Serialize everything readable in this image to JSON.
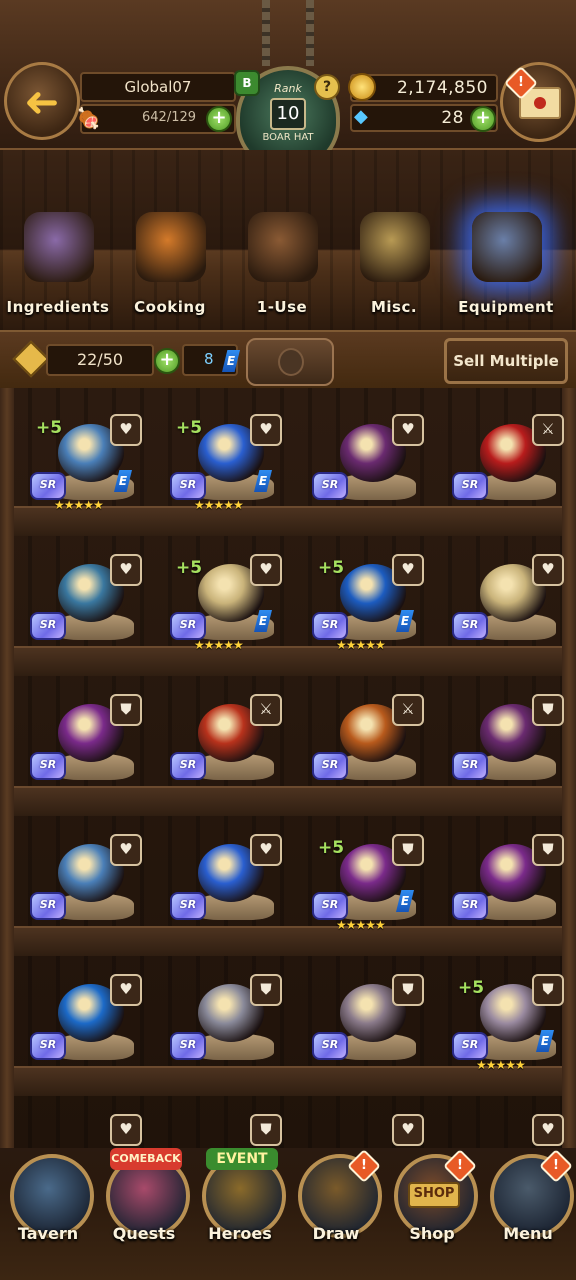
{
  "header": {
    "player_name": "Global07",
    "stamina": "642/129",
    "rank_label": "Rank",
    "rank_value": "10",
    "rank_title": "BOAR HAT",
    "rank_badge_letter": "B",
    "help_glyph": "?",
    "gold": "2,174,850",
    "gems": "28",
    "plus_glyph": "+",
    "alert_glyph": "!",
    "back_glyph": "➜"
  },
  "categories": [
    {
      "label": "Ingredients",
      "icon": "ingredients-icon",
      "active": false
    },
    {
      "label": "Cooking",
      "icon": "cooking-icon",
      "active": false
    },
    {
      "label": "1-Use",
      "icon": "one-use-bag-icon",
      "active": false
    },
    {
      "label": "Misc.",
      "icon": "misc-trophy-icon",
      "active": false
    },
    {
      "label": "Equipment",
      "icon": "equipment-armor-icon",
      "active": true
    }
  ],
  "inventory": {
    "count": "22/50",
    "tickets": "8",
    "e_label": "E",
    "sell_label": "Sell Multiple"
  },
  "grid": {
    "rarity_label": "SR",
    "e_label": "E",
    "items": [
      {
        "plus": "+5",
        "lock": "♥",
        "e": true,
        "stars": 5,
        "art": "#4a7fb8"
      },
      {
        "plus": "+5",
        "lock": "♥",
        "e": true,
        "stars": 5,
        "art": "#2a5fd0"
      },
      {
        "plus": "",
        "lock": "♥",
        "e": false,
        "stars": 0,
        "art": "#6a2a70"
      },
      {
        "plus": "",
        "lock": "⚔",
        "e": false,
        "stars": 0,
        "art": "#b81c1c"
      },
      {
        "plus": "",
        "lock": "♥",
        "e": false,
        "stars": 0,
        "art": "#3a78a0"
      },
      {
        "plus": "+5",
        "lock": "♥",
        "e": true,
        "stars": 5,
        "art": "#c9b37a"
      },
      {
        "plus": "+5",
        "lock": "♥",
        "e": true,
        "stars": 5,
        "art": "#1c5cc0"
      },
      {
        "plus": "",
        "lock": "♥",
        "e": false,
        "stars": 0,
        "art": "#c9b37a"
      },
      {
        "plus": "",
        "lock": "⛊",
        "e": false,
        "stars": 0,
        "art": "#7a2a8a"
      },
      {
        "plus": "",
        "lock": "⚔",
        "e": false,
        "stars": 0,
        "art": "#b8321c"
      },
      {
        "plus": "",
        "lock": "⚔",
        "e": false,
        "stars": 0,
        "art": "#b85a1c"
      },
      {
        "plus": "",
        "lock": "⛊",
        "e": false,
        "stars": 0,
        "art": "#6a2a70"
      },
      {
        "plus": "",
        "lock": "♥",
        "e": false,
        "stars": 0,
        "art": "#4a7fb8"
      },
      {
        "plus": "",
        "lock": "♥",
        "e": false,
        "stars": 0,
        "art": "#2a5fd0"
      },
      {
        "plus": "+5",
        "lock": "⛊",
        "e": true,
        "stars": 5,
        "art": "#7a2a8a"
      },
      {
        "plus": "",
        "lock": "⛊",
        "e": false,
        "stars": 0,
        "art": "#7a2a8a"
      },
      {
        "plus": "",
        "lock": "♥",
        "e": false,
        "stars": 0,
        "art": "#1c6ac8"
      },
      {
        "plus": "",
        "lock": "⛊",
        "e": false,
        "stars": 0,
        "art": "#8a8a9a"
      },
      {
        "plus": "",
        "lock": "⛊",
        "e": false,
        "stars": 0,
        "art": "#8a7a8a"
      },
      {
        "plus": "+5",
        "lock": "⛊",
        "e": true,
        "stars": 5,
        "art": "#9a8aa0"
      }
    ],
    "partial_row_locks": [
      "♥",
      "⛊",
      "♥",
      "♥"
    ]
  },
  "nav": [
    {
      "label": "Tavern",
      "icon": "tavern-hat-icon",
      "ribbon": "",
      "badge": false
    },
    {
      "label": "Quests",
      "icon": "quests-scroll-icon",
      "ribbon": "COMEBACK",
      "badge": false
    },
    {
      "label": "Heroes",
      "icon": "heroes-helmet-icon",
      "ribbon": "EVENT",
      "badge": false
    },
    {
      "label": "Draw",
      "icon": "draw-gem-icon",
      "ribbon": "",
      "badge": true
    },
    {
      "label": "Shop",
      "icon": "shop-sign-icon",
      "ribbon": "",
      "badge": true,
      "sign": "SHOP"
    },
    {
      "label": "Menu",
      "icon": "menu-gear-icon",
      "ribbon": "",
      "badge": true
    }
  ]
}
